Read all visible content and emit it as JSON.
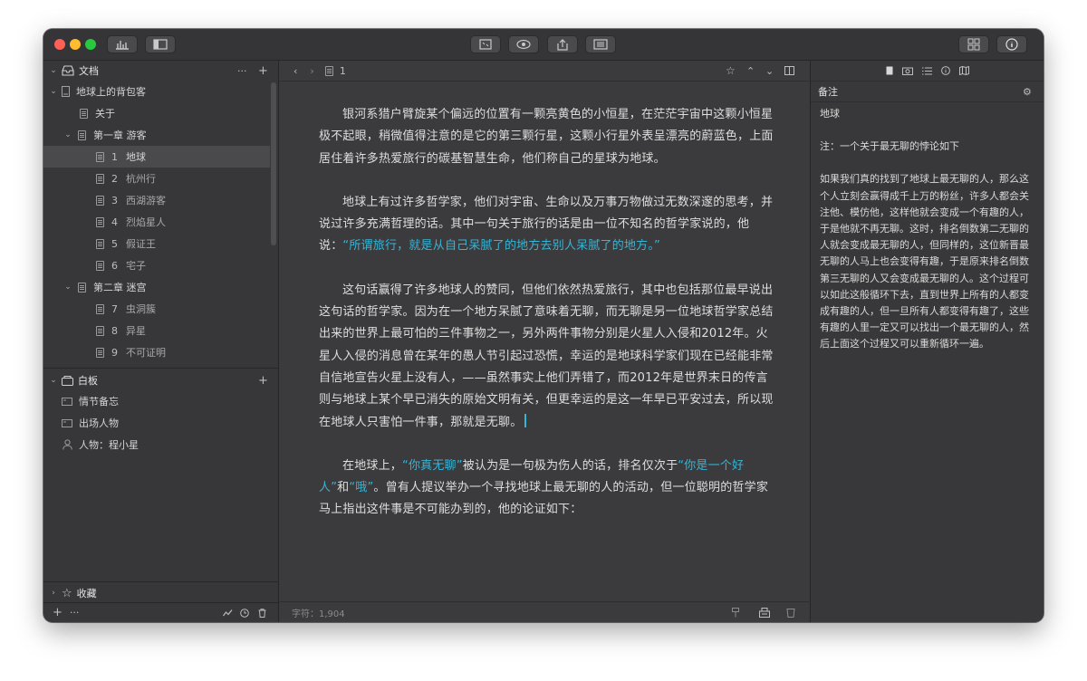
{
  "colors": {
    "accent": "#36b5d6",
    "window_bg": "#3a3a3c",
    "close": "#fe5f57",
    "minimize": "#febc2e",
    "zoom": "#28c840"
  },
  "sidebar": {
    "documents_header": "文档",
    "project": "地球上的背包客",
    "about": "关于",
    "chapter1": "第一章 游客",
    "chapter1_items": [
      {
        "num": "1",
        "label": "地球"
      },
      {
        "num": "2",
        "label": "杭州行"
      },
      {
        "num": "3",
        "label": "西湖游客"
      },
      {
        "num": "4",
        "label": "烈焰星人"
      },
      {
        "num": "5",
        "label": "假证王"
      },
      {
        "num": "6",
        "label": "宅子"
      }
    ],
    "chapter2": "第二章 迷宫",
    "chapter2_items": [
      {
        "num": "7",
        "label": "虫洞簇"
      },
      {
        "num": "8",
        "label": "异星"
      },
      {
        "num": "9",
        "label": "不可证明"
      }
    ],
    "whiteboard_header": "白板",
    "whiteboard_items": [
      {
        "label": "情节备忘",
        "icon": "card-icon"
      },
      {
        "label": "出场人物",
        "icon": "card-icon"
      },
      {
        "label": "人物：程小星",
        "icon": "person-icon"
      }
    ],
    "favorites": "收藏",
    "more": "···",
    "add": "+"
  },
  "editor": {
    "page_label": "1",
    "word_count": "字符：1,904",
    "paragraphs": {
      "p1": "银河系猎户臂旋某个偏远的位置有一颗亮黄色的小恒星，在茫茫宇宙中这颗小恒星极不起眼，稍微值得注意的是它的第三颗行星，这颗小行星外表呈漂亮的蔚蓝色，上面居住着许多热爱旅行的碳基智慧生命，他们称自己的星球为地球。",
      "p2_a": "地球上有过许多哲学家，他们对宇宙、生命以及万事万物做过无数深邃的思考，并说过许多充满哲理的话。其中一句关于旅行的话是由一位不知名的哲学家说的，他说：",
      "p2_quote": "“所谓旅行，就是从自己呆腻了的地方去别人呆腻了的地方。”",
      "p3": "这句话赢得了许多地球人的赞同，但他们依然热爱旅行，其中也包括那位最早说出这句话的哲学家。因为在一个地方呆腻了意味着无聊，而无聊是另一位地球哲学家总结出来的世界上最可怕的三件事物之一，另外两件事物分别是火星人入侵和2012年。火星人入侵的消息曾在某年的愚人节引起过恐慌，幸运的是地球科学家们现在已经能非常自信地宣告火星上没有人，——虽然事实上他们弄错了，而2012年是世界末日的传言则与地球上某个早已消失的原始文明有关，但更幸运的是这一年早已平安过去，所以现在地球人只害怕一件事，那就是无聊。",
      "p4_a": "在地球上，",
      "p4_q1": "“你真无聊”",
      "p4_b": "被认为是一句极为伤人的话，排名仅次于",
      "p4_q2": "“你是一个好人”",
      "p4_c": "和",
      "p4_q3": "“哦”",
      "p4_d": "。曾有人提议举办一个寻找地球上最无聊的人的活动，但一位聪明的哲学家马上指出这件事是不可能办到的，他的论证如下："
    }
  },
  "inspector": {
    "header": "备注",
    "note_title": "地球",
    "note_line2": "注：一个关于最无聊的悖论如下",
    "note_body": "如果我们真的找到了地球上最无聊的人，那么这个人立刻会赢得成千上万的粉丝，许多人都会关注他、模仿他，这样他就会变成一个有趣的人，于是他就不再无聊。这时，排名倒数第二无聊的人就会变成最无聊的人，但同样的，这位新晋最无聊的人马上也会变得有趣，于是原来排名倒数第三无聊的人又会变成最无聊的人。这个过程可以如此这般循环下去，直到世界上所有的人都变成有趣的人，但一旦所有人都变得有趣了，这些有趣的人里一定又可以找出一个最无聊的人，然后上面这个过程又可以重新循环一遍。"
  }
}
